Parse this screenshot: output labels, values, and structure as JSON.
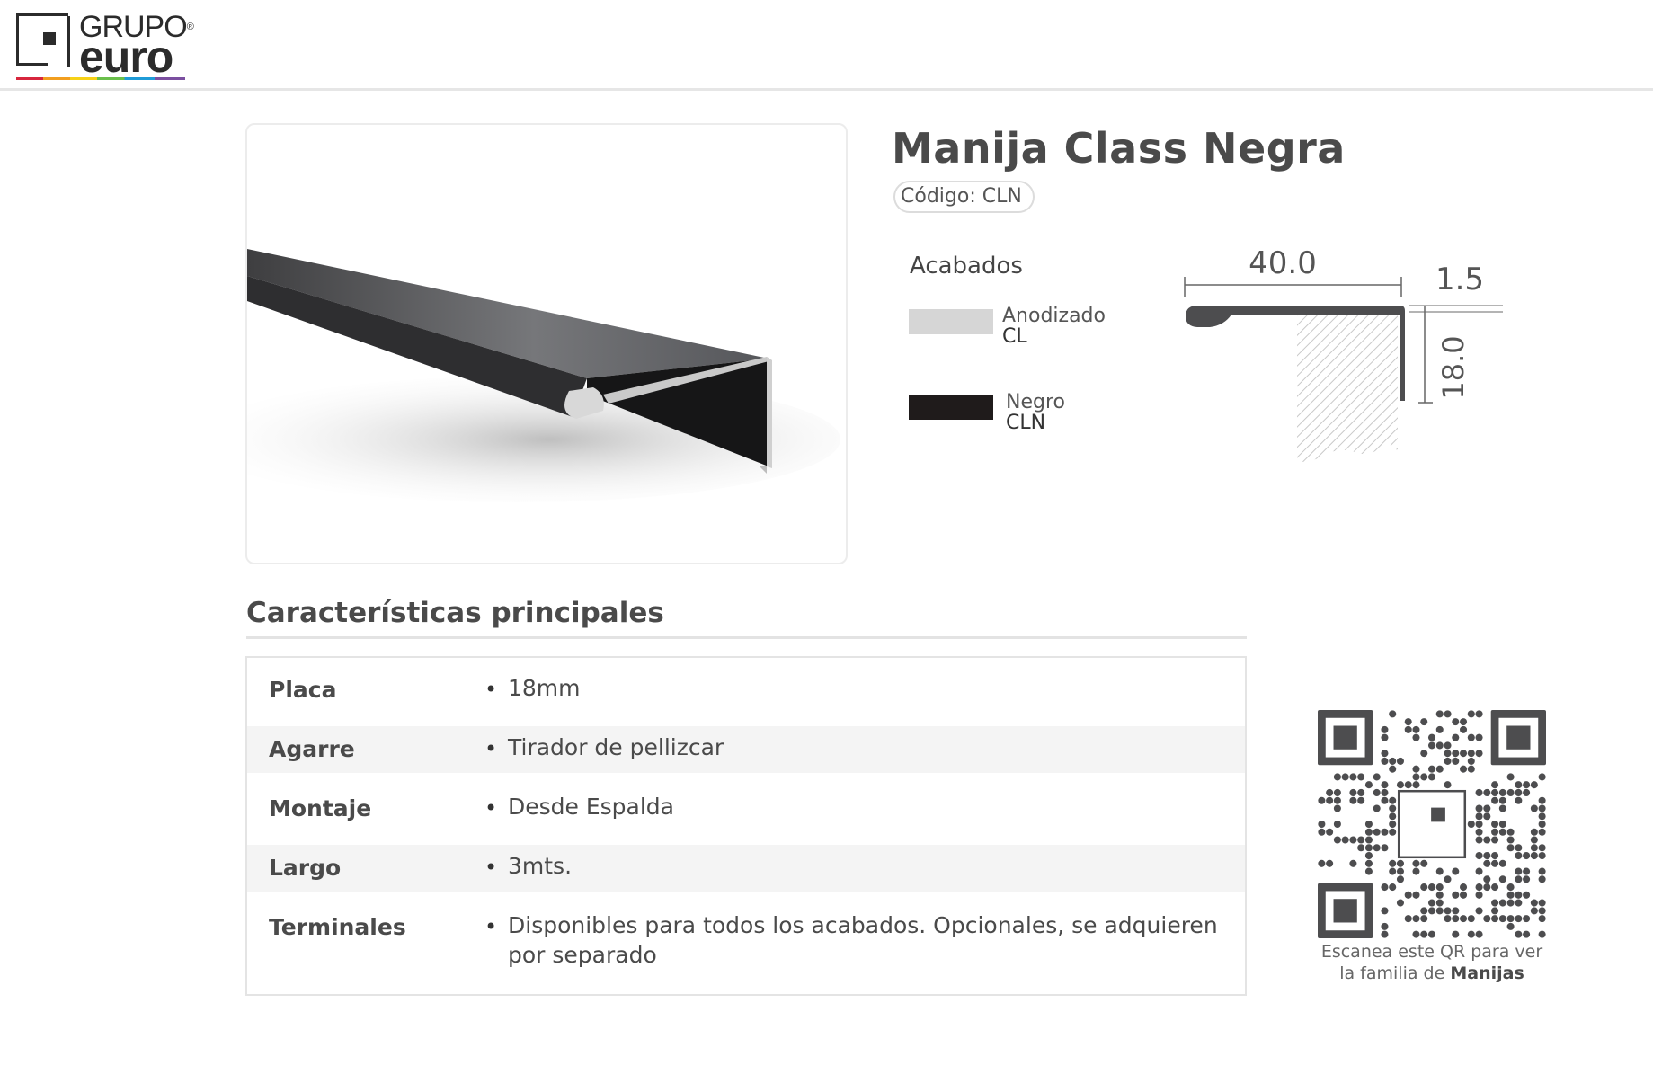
{
  "brand": {
    "line1": "GRUPO",
    "reg": "®",
    "line2": "euro"
  },
  "product": {
    "title": "Manija Class Negra",
    "code_label": "Código: CLN"
  },
  "finishes": {
    "title": "Acabados",
    "items": [
      {
        "name": "Anodizado",
        "code": "CL",
        "color": "#d6d6d6"
      },
      {
        "name": "Negro",
        "code": "CLN",
        "color": "#1f1b1b"
      }
    ]
  },
  "profile": {
    "width_label": "40.0",
    "thickness_label": "1.5",
    "height_label": "18.0"
  },
  "specs": {
    "title": "Características principales",
    "rows": [
      {
        "label": "Placa",
        "value": "18mm"
      },
      {
        "label": "Agarre",
        "value": "Tirador de pellizcar"
      },
      {
        "label": "Montaje",
        "value": "Desde Espalda"
      },
      {
        "label": "Largo",
        "value": "3mts."
      },
      {
        "label": "Terminales",
        "value": "Disponibles para todos los acabados. Opcionales, se adquieren por separado"
      }
    ],
    "bullet": "•"
  },
  "qr": {
    "caption_line1": "Escanea este QR para ver",
    "caption_line2_prefix": "la familia de ",
    "caption_line2_bold": "Manijas"
  }
}
